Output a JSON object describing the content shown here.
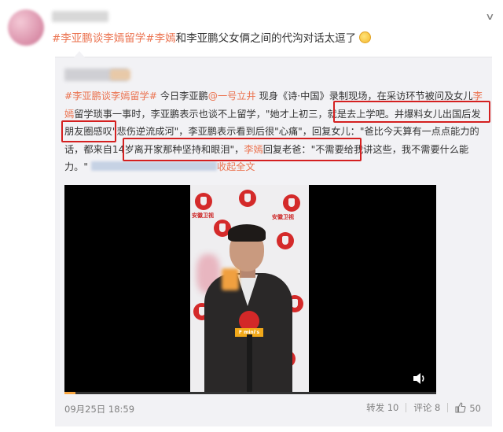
{
  "post": {
    "hashtag1": "#李亚鹏谈李嫣留学#",
    "mention": "李嫣",
    "text": "和李亚鹏父女俩之间的代沟对话太逗了"
  },
  "repost": {
    "hashtag": "#李亚鹏谈李嫣留学#",
    "seg1": "今日李亚鹏",
    "at_user": "@一号立井",
    "seg2": "现身《诗·中国》录制现场，在采访环节被问及女儿",
    "name": "李嫣",
    "seg3": "留学琐事一事时，李亚鹏表示也谈不上留学，\"她才上初三，就是去上学吧。",
    "highlight1": "并爆料女儿出国后发朋友圈感叹\"悲伤逆流成河\"",
    "seg4": "，李亚鹏表示看到后很\"心痛\"，回复女儿：\"爸比今天算有一点点能力的话，都来自14岁离开家那种坚持和眼泪\"，",
    "highlight2_name": "李嫣",
    "highlight2_text": "回复老爸：\"不需要给我讲这些，我不需要什么能力。\"",
    "expand": "收起全文",
    "timestamp": "09月25日 18:59",
    "repost_label": "转发 10",
    "comment_label": "评论 8",
    "like_count": "50"
  },
  "video": {
    "logo_text": "安徽卫视",
    "mic_label": "F mini's",
    "progress": 0.03
  },
  "colors": {
    "link": "#eb7350",
    "highlight_border": "#d42020"
  }
}
